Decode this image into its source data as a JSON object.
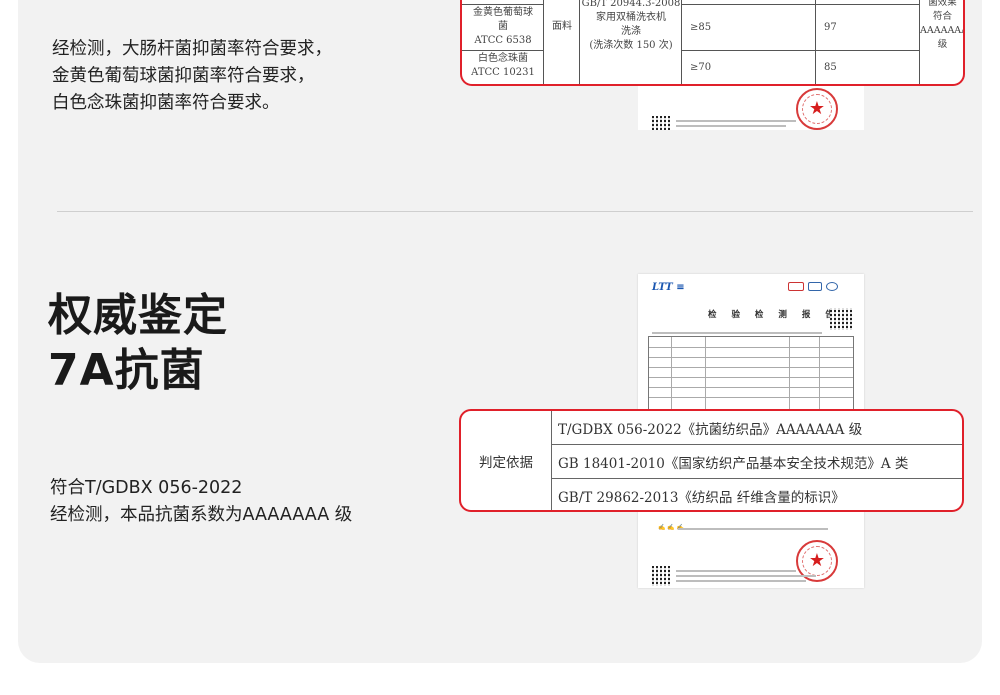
{
  "section1": {
    "lines": [
      "经检测，大肠杆菌抑菌率符合要求，",
      "金黄色葡萄球菌抑菌率符合要求，",
      "白色念珠菌抑菌率符合要求。"
    ],
    "table": {
      "cell_bacteria1": [
        "金黄色葡萄球",
        "菌",
        "ATCC 6538"
      ],
      "cell_bacteria2": [
        "白色念珠菌",
        "ATCC 10231"
      ],
      "cell_fabric": "面料",
      "cell_method": [
        "GB/T 20944.3-2008",
        "家用双桶洗衣机",
        "洗涤",
        "(洗涤次数 150 次)"
      ],
      "val1_req": "≥85",
      "val1_res": "97",
      "val2_req": "≥70",
      "val2_res": "85",
      "cell_result": [
        "菌效果",
        "符合",
        "AAAAAAA",
        "级"
      ]
    }
  },
  "section2": {
    "title_line1": "权威鉴定",
    "title_line2": "7A抗菌",
    "desc_lines": [
      "符合T/GDBX 056-2022",
      "经检测，本品抗菌系数为AAAAAAA 级"
    ],
    "report_title": "检 验 检 测 报 告",
    "table": {
      "label": "判定依据",
      "rows": [
        "T/GDBX 056-2022《抗菌纺织品》AAAAAAA 级",
        "GB 18401-2010《国家纺织产品基本安全技术规范》A 类",
        "GB/T 29862-2013《纺织品 纤维含量的标识》"
      ]
    }
  },
  "colors": {
    "accent_red": "#e0202a",
    "card_bg": "#f2f2f2"
  }
}
